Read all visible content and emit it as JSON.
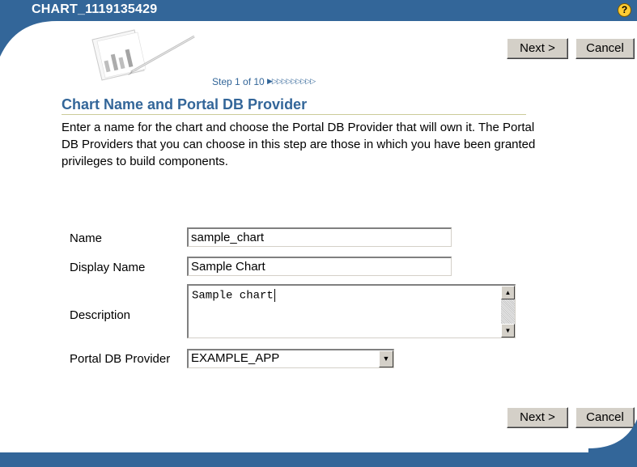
{
  "header": {
    "title": "CHART_1119135429",
    "help_icon": "help-icon",
    "help_glyph": "?"
  },
  "wizard": {
    "step_text": "Step 1 of 10",
    "step_arrows": "▶▷▷▷▷▷▷▷▷▷"
  },
  "buttons": {
    "next_label": "Next >",
    "cancel_label": "Cancel"
  },
  "section": {
    "title": "Chart Name and Portal DB Provider",
    "intro": "Enter a name for the chart and choose the Portal DB Provider that will own it. The Portal DB Providers that you can choose in this step are those in which you have been granted privileges to build components."
  },
  "form": {
    "name_label": "Name",
    "name_value": "sample_chart",
    "display_name_label": "Display Name",
    "display_name_value": "Sample Chart",
    "description_label": "Description",
    "description_value": "Sample chart",
    "provider_label": "Portal DB Provider",
    "provider_value": "EXAMPLE_APP"
  },
  "colors": {
    "brand_blue": "#336699",
    "rule": "#cccc99",
    "button_face": "#d4d0c8"
  }
}
